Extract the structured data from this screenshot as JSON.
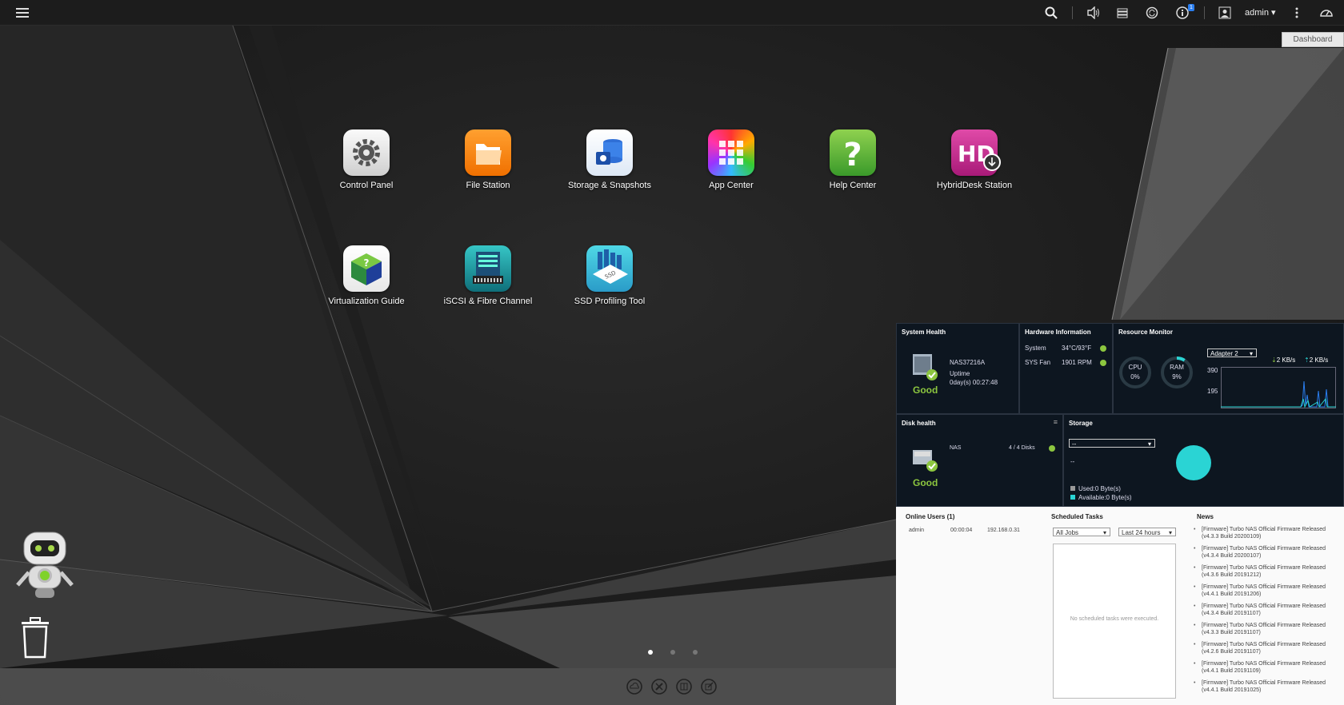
{
  "topbar": {
    "menu_icon": "hamburger-icon",
    "user": "admin",
    "notification_badge": "1",
    "icons": [
      "search-icon",
      "volume-icon",
      "stack-icon",
      "sync-icon",
      "info-icon",
      "user-icon",
      "more-icon",
      "dashboard-gauge-icon"
    ]
  },
  "dashboard_button": "Dashboard",
  "apps": [
    {
      "label": "Control Panel",
      "icon": "gear-icon"
    },
    {
      "label": "File Station",
      "icon": "folder-icon"
    },
    {
      "label": "Storage & Snapshots",
      "icon": "database-icon"
    },
    {
      "label": "App Center",
      "icon": "grid-icon"
    },
    {
      "label": "Help Center",
      "icon": "question-icon"
    },
    {
      "label": "HybridDesk Station",
      "icon": "hd-icon"
    },
    {
      "label": "Virtualization Guide",
      "icon": "cube-icon"
    },
    {
      "label": "iSCSI & Fibre Channel",
      "icon": "server-icon"
    },
    {
      "label": "SSD Profiling Tool",
      "icon": "ssd-icon"
    }
  ],
  "system_health": {
    "title": "System Health",
    "device": "NAS37216A",
    "uptime_label": "Uptime",
    "uptime": "0day(s) 00:27:48",
    "status": "Good"
  },
  "hardware": {
    "title": "Hardware Information",
    "rows": [
      {
        "name": "System",
        "value": "34°C/93°F"
      },
      {
        "name": "SYS Fan",
        "value": "1901 RPM"
      }
    ]
  },
  "resource_monitor": {
    "title": "Resource Monitor",
    "cpu_label": "CPU",
    "cpu_value": "0%",
    "cpu_pct": 0,
    "ram_label": "RAM",
    "ram_value": "9%",
    "ram_pct": 9,
    "adapter": "Adapter 2",
    "down_rate": "2 KB/s",
    "up_rate": "2 KB/s",
    "y_top": "390",
    "y_mid": "195"
  },
  "disk_health": {
    "title": "Disk health",
    "name": "NAS",
    "disks": "4 / 4 Disks",
    "status": "Good"
  },
  "storage": {
    "title": "Storage",
    "select": "--",
    "value": "--",
    "used": "Used:0 Byte(s)",
    "available": "Available:0 Byte(s)"
  },
  "online_users": {
    "title": "Online Users (1)",
    "rows": [
      {
        "user": "admin",
        "time": "00:00:04",
        "ip": "192.168.0.31"
      }
    ]
  },
  "scheduled_tasks": {
    "title": "Scheduled Tasks",
    "filter1": "All Jobs",
    "filter2": "Last 24 hours",
    "empty": "No scheduled tasks were executed."
  },
  "news": {
    "title": "News",
    "items": [
      "[Firmware] Turbo NAS Official Firmware Released (v4.3.3 Build 20200109)",
      "[Firmware] Turbo NAS Official Firmware Released (v4.3.4 Build 20200107)",
      "[Firmware] Turbo NAS Official Firmware Released (v4.3.6 Build 20191212)",
      "[Firmware] Turbo NAS Official Firmware Released (v4.4.1 Build 20191206)",
      "[Firmware] Turbo NAS Official Firmware Released (v4.3.4 Build 20191107)",
      "[Firmware] Turbo NAS Official Firmware Released (v4.3.3 Build 20191107)",
      "[Firmware] Turbo NAS Official Firmware Released (v4.2.6 Build 20191107)",
      "[Firmware] Turbo NAS Official Firmware Released (v4.4.1 Build 20191109)",
      "[Firmware] Turbo NAS Official Firmware Released (v4.4.1 Build 20191025)"
    ]
  },
  "colors": {
    "accent": "#2ad4d4",
    "good": "#8cc63f",
    "panel_bg": "#0d1620"
  }
}
